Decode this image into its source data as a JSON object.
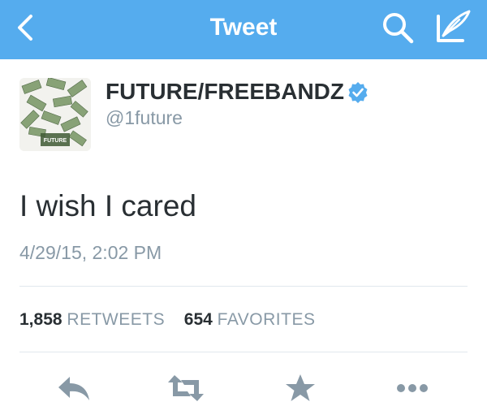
{
  "navbar": {
    "title": "Tweet",
    "back_icon": "chevron-left-icon",
    "search_icon": "search-icon",
    "compose_icon": "compose-icon",
    "background": "#55acee"
  },
  "tweet": {
    "avatar_label": "FUTURE",
    "display_name": "FUTURE/FREEBANDZ",
    "verified": true,
    "handle": "@1future",
    "text": "I wish I cared",
    "timestamp": "4/29/15, 2:02 PM"
  },
  "stats": {
    "retweets_count": "1,858",
    "retweets_label": "RETWEETS",
    "favorites_count": "654",
    "favorites_label": "FAVORITES"
  },
  "actions": {
    "reply_icon": "reply-icon",
    "retweet_icon": "retweet-icon",
    "favorite_icon": "star-icon",
    "more_icon": "more-icon",
    "icon_color": "#8899a6"
  }
}
